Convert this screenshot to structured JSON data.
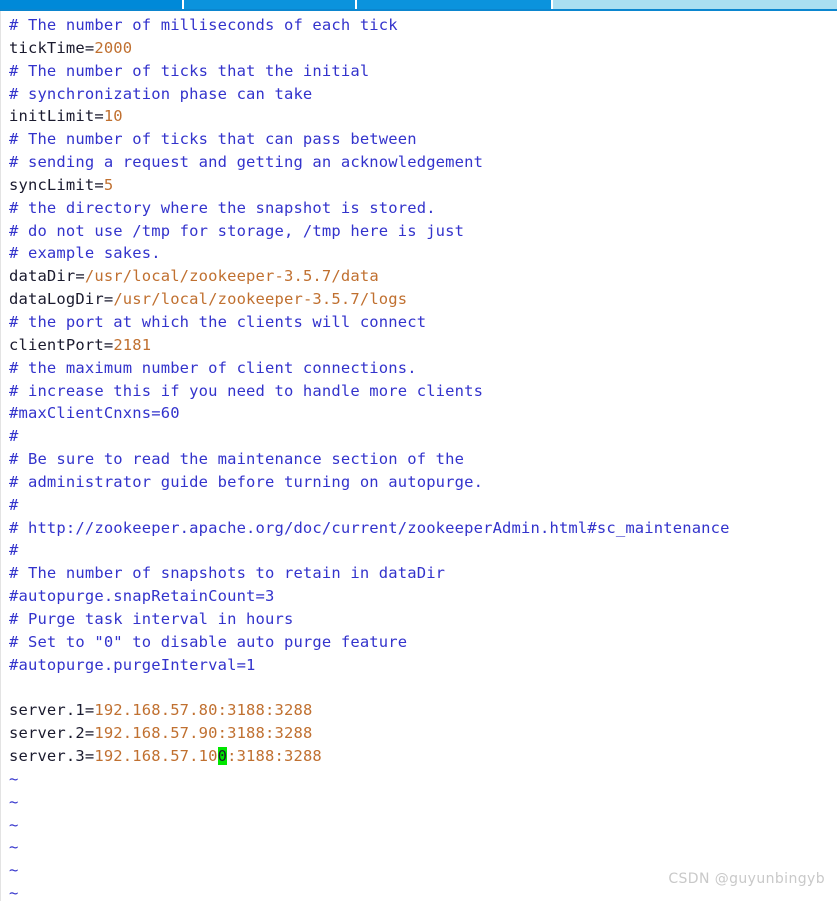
{
  "toolbar": {
    "segments": [
      {
        "name": "tab-active",
        "color": "#0089d8"
      },
      {
        "name": "tab-second",
        "color": "#0b93dd"
      },
      {
        "name": "tab-third",
        "color": "#0b93dd"
      },
      {
        "name": "tab-rest",
        "color": "#aadff1"
      }
    ],
    "underline_color": "#0b86cf"
  },
  "colors": {
    "comment": "#3333cc",
    "key": "#1a1a2e",
    "value": "#c07030",
    "tilde": "#3333cc",
    "cursor_background": "#00e600",
    "background": "#ffffff",
    "watermark": "#c9c9c9"
  },
  "editor": {
    "filetype": "config",
    "cursor": {
      "character": "0",
      "line_index": 37,
      "column_text": "server.3=192.168.57.100:3188:3288"
    },
    "lines": [
      {
        "kind": "comment",
        "text": "# The number of milliseconds of each tick"
      },
      {
        "kind": "setting",
        "key": "tickTime=",
        "value": "2000"
      },
      {
        "kind": "comment",
        "text": "# The number of ticks that the initial"
      },
      {
        "kind": "comment",
        "text": "# synchronization phase can take"
      },
      {
        "kind": "setting",
        "key": "initLimit=",
        "value": "10"
      },
      {
        "kind": "comment",
        "text": "# The number of ticks that can pass between"
      },
      {
        "kind": "comment",
        "text": "# sending a request and getting an acknowledgement"
      },
      {
        "kind": "setting",
        "key": "syncLimit=",
        "value": "5"
      },
      {
        "kind": "comment",
        "text": "# the directory where the snapshot is stored."
      },
      {
        "kind": "comment",
        "text": "# do not use /tmp for storage, /tmp here is just"
      },
      {
        "kind": "comment",
        "text": "# example sakes."
      },
      {
        "kind": "setting",
        "key": "dataDir=",
        "value": "/usr/local/zookeeper-3.5.7/data"
      },
      {
        "kind": "setting",
        "key": "dataLogDir=",
        "value": "/usr/local/zookeeper-3.5.7/logs"
      },
      {
        "kind": "comment",
        "text": "# the port at which the clients will connect"
      },
      {
        "kind": "setting",
        "key": "clientPort=",
        "value": "2181"
      },
      {
        "kind": "comment",
        "text": "# the maximum number of client connections."
      },
      {
        "kind": "comment",
        "text": "# increase this if you need to handle more clients"
      },
      {
        "kind": "comment",
        "text": "#maxClientCnxns=60"
      },
      {
        "kind": "comment",
        "text": "#"
      },
      {
        "kind": "comment",
        "text": "# Be sure to read the maintenance section of the"
      },
      {
        "kind": "comment",
        "text": "# administrator guide before turning on autopurge."
      },
      {
        "kind": "comment",
        "text": "#"
      },
      {
        "kind": "comment",
        "text": "# http://zookeeper.apache.org/doc/current/zookeeperAdmin.html#sc_maintenance"
      },
      {
        "kind": "comment",
        "text": "#"
      },
      {
        "kind": "comment",
        "text": "# The number of snapshots to retain in dataDir"
      },
      {
        "kind": "comment",
        "text": "#autopurge.snapRetainCount=3"
      },
      {
        "kind": "comment",
        "text": "# Purge task interval in hours"
      },
      {
        "kind": "comment",
        "text": "# Set to \"0\" to disable auto purge feature"
      },
      {
        "kind": "comment",
        "text": "#autopurge.purgeInterval=1"
      },
      {
        "kind": "blank",
        "text": ""
      },
      {
        "kind": "setting",
        "key": "server.1=",
        "value": "192.168.57.80:3188:3288"
      },
      {
        "kind": "setting",
        "key": "server.2=",
        "value": "192.168.57.90:3188:3288"
      },
      {
        "kind": "cursorline",
        "key": "server.3=",
        "pre": "192.168.57.10",
        "cursor": "0",
        "post": ":3188:3288"
      },
      {
        "kind": "tilde",
        "text": "~"
      },
      {
        "kind": "tilde",
        "text": "~"
      },
      {
        "kind": "tilde",
        "text": "~"
      },
      {
        "kind": "tilde",
        "text": "~"
      },
      {
        "kind": "tilde",
        "text": "~"
      },
      {
        "kind": "tilde",
        "text": "~"
      }
    ]
  },
  "watermark": {
    "text": "CSDN @guyunbingyb"
  }
}
